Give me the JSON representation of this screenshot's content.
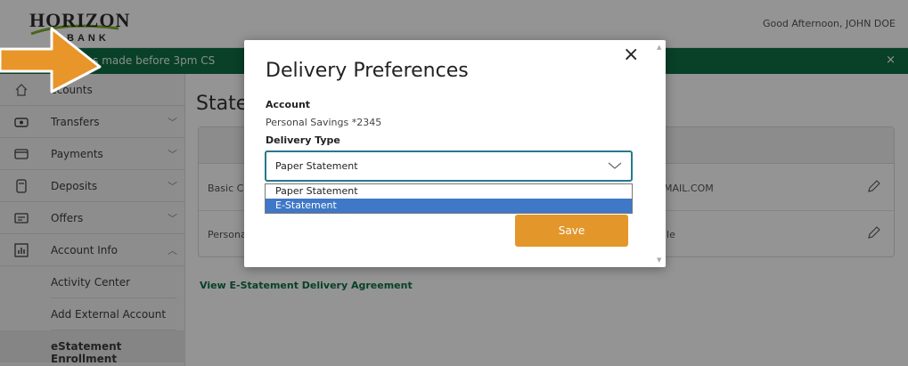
{
  "header": {
    "logo_word": "HORIZON",
    "logo_sub": "BANK",
    "greeting": "Good Afternoon, JOHN DOE"
  },
  "banner": {
    "text": "changes made before 3pm CS",
    "close": "×"
  },
  "sidebar": {
    "items": [
      {
        "label": "ccounts",
        "icon": "home-icon"
      },
      {
        "label": "Transfers",
        "icon": "transfer-icon"
      },
      {
        "label": "Payments",
        "icon": "card-icon"
      },
      {
        "label": "Deposits",
        "icon": "deposit-icon"
      },
      {
        "label": "Offers",
        "icon": "offers-icon"
      },
      {
        "label": "Account Info",
        "icon": "chart-icon"
      }
    ],
    "subitems": [
      "Activity Center",
      "Add External Account",
      "eStatement Enrollment"
    ]
  },
  "main": {
    "title": "State",
    "rows": [
      {
        "account": "Basic Ch",
        "delivery": "MAIL.COM"
      },
      {
        "account": "Persona",
        "delivery": "ile"
      }
    ],
    "agreement_link": "View E-Statement Delivery Agreement"
  },
  "modal": {
    "title": "Delivery Preferences",
    "close": "×",
    "account_label": "Account",
    "account_value": "Personal Savings *2345",
    "delivery_label": "Delivery Type",
    "selected": "Paper Statement",
    "options": [
      "Paper Statement",
      "E-Statement"
    ],
    "highlighted_option": "E-Statement",
    "save_label": "Save"
  },
  "colors": {
    "brand_green": "#0e6f45",
    "save_orange": "#e3962a",
    "select_border": "#27788c",
    "highlight_blue": "#3f78c7",
    "arrow_orange": "#e8952a"
  }
}
